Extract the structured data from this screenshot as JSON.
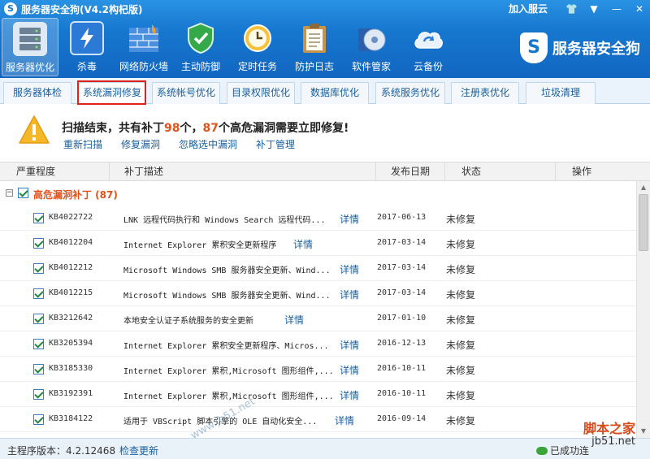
{
  "window": {
    "title": "服务器安全狗(V4.2构杞版)",
    "join_cloud": "加入服云",
    "brand": "服务器安全狗"
  },
  "toolbar": [
    {
      "label": "服务器优化",
      "icon": "server-icon"
    },
    {
      "label": "杀毒",
      "icon": "lightning-shield-icon"
    },
    {
      "label": "网络防火墙",
      "icon": "firewall-icon"
    },
    {
      "label": "主动防御",
      "icon": "shield-check-icon"
    },
    {
      "label": "定时任务",
      "icon": "clock-icon"
    },
    {
      "label": "防护日志",
      "icon": "clipboard-icon"
    },
    {
      "label": "软件管家",
      "icon": "software-disc-icon"
    },
    {
      "label": "云备份",
      "icon": "cloud-sync-icon"
    }
  ],
  "tabs": [
    {
      "label": "服务器体检"
    },
    {
      "label": "系统漏洞修复"
    },
    {
      "label": "系统帐号优化"
    },
    {
      "label": "目录权限优化"
    },
    {
      "label": "数据库优化"
    },
    {
      "label": "系统服务优化"
    },
    {
      "label": "注册表优化"
    },
    {
      "label": "垃圾清理"
    }
  ],
  "notice": {
    "prefix": "扫描结束，共有补丁",
    "total": "98",
    "middle": "个，",
    "high_risk": "87",
    "suffix": "个高危漏洞需要立即修复!",
    "links": [
      "重新扫描",
      "修复漏洞",
      "忽略选中漏洞",
      "补丁管理"
    ]
  },
  "table": {
    "columns": [
      "严重程度",
      "补丁描述",
      "发布日期",
      "状态",
      "操作"
    ],
    "group_label": "高危漏洞补丁 (87)",
    "detail_label": "详情",
    "rows": [
      {
        "kb": "KB4022722",
        "desc": "LNK 远程代码执行和 Windows Search 远程代码...",
        "date": "2017-06-13",
        "status": "未修复"
      },
      {
        "kb": "KB4012204",
        "desc": "Internet Explorer 累积安全更新程序",
        "date": "2017-03-14",
        "status": "未修复"
      },
      {
        "kb": "KB4012212",
        "desc": "Microsoft Windows SMB 服务器安全更新、Wind...",
        "date": "2017-03-14",
        "status": "未修复"
      },
      {
        "kb": "KB4012215",
        "desc": "Microsoft Windows SMB 服务器安全更新、Wind...",
        "date": "2017-03-14",
        "status": "未修复"
      },
      {
        "kb": "KB3212642",
        "desc": "本地安全认证子系统服务的安全更新",
        "date": "2017-01-10",
        "status": "未修复"
      },
      {
        "kb": "KB3205394",
        "desc": "Internet Explorer 累积安全更新程序、Micros...",
        "date": "2016-12-13",
        "status": "未修复"
      },
      {
        "kb": "KB3185330",
        "desc": "Internet Explorer 累积,Microsoft 图形组件,...",
        "date": "2016-10-11",
        "status": "未修复"
      },
      {
        "kb": "KB3192391",
        "desc": "Internet Explorer 累积,Microsoft 图形组件,...",
        "date": "2016-10-11",
        "status": "未修复"
      },
      {
        "kb": "KB3184122",
        "desc": "适用于 VBScript 脚本引擎的 OLE 自动化安全...",
        "date": "2016-09-14",
        "status": "未修复"
      }
    ]
  },
  "statusbar": {
    "version": "主程序版本：4.2.12468",
    "check_update": "检查更新",
    "connected": "已成功连"
  },
  "watermarks": {
    "diagonal": "www.jb51.net",
    "corner_top": "脚本之家",
    "corner_bottom": "jb51.net"
  }
}
